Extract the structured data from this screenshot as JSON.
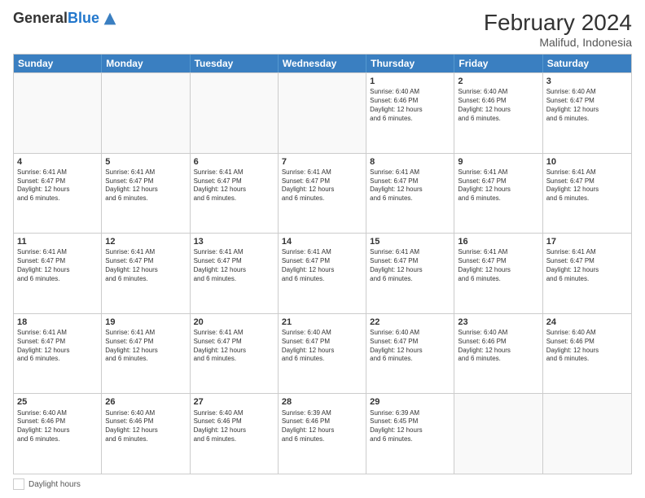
{
  "header": {
    "logo_general": "General",
    "logo_blue": "Blue",
    "month_year": "February 2024",
    "location": "Malifud, Indonesia"
  },
  "days_of_week": [
    "Sunday",
    "Monday",
    "Tuesday",
    "Wednesday",
    "Thursday",
    "Friday",
    "Saturday"
  ],
  "weeks": [
    [
      {
        "day": "",
        "info": ""
      },
      {
        "day": "",
        "info": ""
      },
      {
        "day": "",
        "info": ""
      },
      {
        "day": "",
        "info": ""
      },
      {
        "day": "1",
        "info": "Sunrise: 6:40 AM\nSunset: 6:46 PM\nDaylight: 12 hours\nand 6 minutes."
      },
      {
        "day": "2",
        "info": "Sunrise: 6:40 AM\nSunset: 6:46 PM\nDaylight: 12 hours\nand 6 minutes."
      },
      {
        "day": "3",
        "info": "Sunrise: 6:40 AM\nSunset: 6:47 PM\nDaylight: 12 hours\nand 6 minutes."
      }
    ],
    [
      {
        "day": "4",
        "info": "Sunrise: 6:41 AM\nSunset: 6:47 PM\nDaylight: 12 hours\nand 6 minutes."
      },
      {
        "day": "5",
        "info": "Sunrise: 6:41 AM\nSunset: 6:47 PM\nDaylight: 12 hours\nand 6 minutes."
      },
      {
        "day": "6",
        "info": "Sunrise: 6:41 AM\nSunset: 6:47 PM\nDaylight: 12 hours\nand 6 minutes."
      },
      {
        "day": "7",
        "info": "Sunrise: 6:41 AM\nSunset: 6:47 PM\nDaylight: 12 hours\nand 6 minutes."
      },
      {
        "day": "8",
        "info": "Sunrise: 6:41 AM\nSunset: 6:47 PM\nDaylight: 12 hours\nand 6 minutes."
      },
      {
        "day": "9",
        "info": "Sunrise: 6:41 AM\nSunset: 6:47 PM\nDaylight: 12 hours\nand 6 minutes."
      },
      {
        "day": "10",
        "info": "Sunrise: 6:41 AM\nSunset: 6:47 PM\nDaylight: 12 hours\nand 6 minutes."
      }
    ],
    [
      {
        "day": "11",
        "info": "Sunrise: 6:41 AM\nSunset: 6:47 PM\nDaylight: 12 hours\nand 6 minutes."
      },
      {
        "day": "12",
        "info": "Sunrise: 6:41 AM\nSunset: 6:47 PM\nDaylight: 12 hours\nand 6 minutes."
      },
      {
        "day": "13",
        "info": "Sunrise: 6:41 AM\nSunset: 6:47 PM\nDaylight: 12 hours\nand 6 minutes."
      },
      {
        "day": "14",
        "info": "Sunrise: 6:41 AM\nSunset: 6:47 PM\nDaylight: 12 hours\nand 6 minutes."
      },
      {
        "day": "15",
        "info": "Sunrise: 6:41 AM\nSunset: 6:47 PM\nDaylight: 12 hours\nand 6 minutes."
      },
      {
        "day": "16",
        "info": "Sunrise: 6:41 AM\nSunset: 6:47 PM\nDaylight: 12 hours\nand 6 minutes."
      },
      {
        "day": "17",
        "info": "Sunrise: 6:41 AM\nSunset: 6:47 PM\nDaylight: 12 hours\nand 6 minutes."
      }
    ],
    [
      {
        "day": "18",
        "info": "Sunrise: 6:41 AM\nSunset: 6:47 PM\nDaylight: 12 hours\nand 6 minutes."
      },
      {
        "day": "19",
        "info": "Sunrise: 6:41 AM\nSunset: 6:47 PM\nDaylight: 12 hours\nand 6 minutes."
      },
      {
        "day": "20",
        "info": "Sunrise: 6:41 AM\nSunset: 6:47 PM\nDaylight: 12 hours\nand 6 minutes."
      },
      {
        "day": "21",
        "info": "Sunrise: 6:40 AM\nSunset: 6:47 PM\nDaylight: 12 hours\nand 6 minutes."
      },
      {
        "day": "22",
        "info": "Sunrise: 6:40 AM\nSunset: 6:47 PM\nDaylight: 12 hours\nand 6 minutes."
      },
      {
        "day": "23",
        "info": "Sunrise: 6:40 AM\nSunset: 6:46 PM\nDaylight: 12 hours\nand 6 minutes."
      },
      {
        "day": "24",
        "info": "Sunrise: 6:40 AM\nSunset: 6:46 PM\nDaylight: 12 hours\nand 6 minutes."
      }
    ],
    [
      {
        "day": "25",
        "info": "Sunrise: 6:40 AM\nSunset: 6:46 PM\nDaylight: 12 hours\nand 6 minutes."
      },
      {
        "day": "26",
        "info": "Sunrise: 6:40 AM\nSunset: 6:46 PM\nDaylight: 12 hours\nand 6 minutes."
      },
      {
        "day": "27",
        "info": "Sunrise: 6:40 AM\nSunset: 6:46 PM\nDaylight: 12 hours\nand 6 minutes."
      },
      {
        "day": "28",
        "info": "Sunrise: 6:39 AM\nSunset: 6:46 PM\nDaylight: 12 hours\nand 6 minutes."
      },
      {
        "day": "29",
        "info": "Sunrise: 6:39 AM\nSunset: 6:45 PM\nDaylight: 12 hours\nand 6 minutes."
      },
      {
        "day": "",
        "info": ""
      },
      {
        "day": "",
        "info": ""
      }
    ]
  ],
  "footer": {
    "box_label": "Daylight hours"
  }
}
